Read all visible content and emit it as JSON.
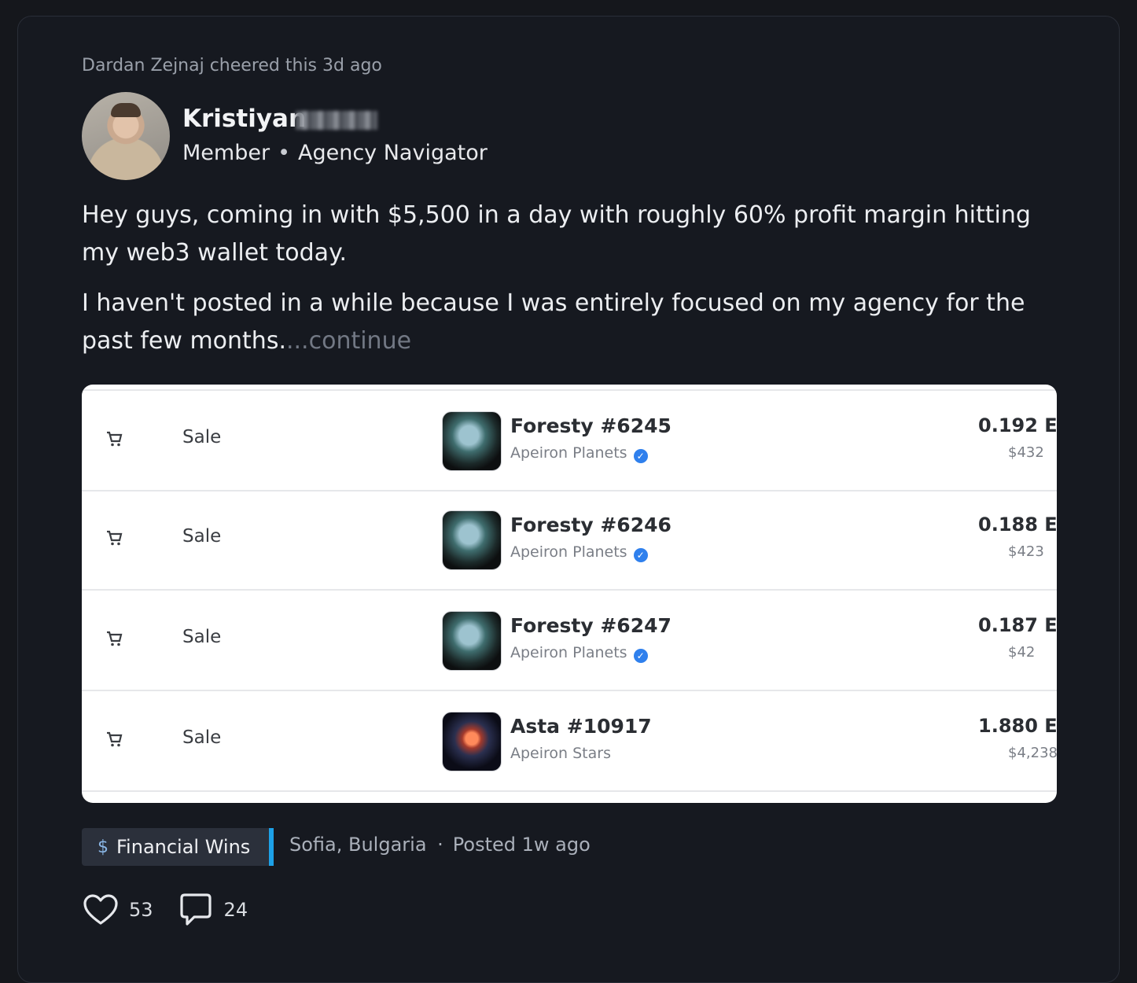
{
  "post": {
    "cheer_text": "Dardan Zejnaj cheered this 3d ago",
    "author": {
      "name": "Kristiyan",
      "role": "Member",
      "title": "Agency Navigator"
    },
    "paragraphs": [
      "Hey guys, coming in with $5,500 in a day with roughly 60% profit margin hitting my web3 wallet today.",
      "I haven't posted in a while because I was entirely focused on my agency for the past few months."
    ],
    "continue_label": "...continue",
    "screenshot_rows": [
      {
        "event": "Sale",
        "item": "Foresty #6245",
        "collection": "Apeiron Planets",
        "verified": true,
        "price": "0.192 E",
        "usd": "$432"
      },
      {
        "event": "Sale",
        "item": "Foresty #6246",
        "collection": "Apeiron Planets",
        "verified": true,
        "price": "0.188 E",
        "usd": "$423"
      },
      {
        "event": "Sale",
        "item": "Foresty #6247",
        "collection": "Apeiron Planets",
        "verified": true,
        "price": "0.187 E",
        "usd": "$42"
      },
      {
        "event": "Sale",
        "item": "Asta #10917",
        "collection": "Apeiron Stars",
        "verified": false,
        "price": "1.880 E",
        "usd": "$4,238"
      }
    ],
    "category": "Financial Wins",
    "location": "Sofia, Bulgaria",
    "posted": "Posted 1w ago",
    "likes": "53",
    "comments": "24",
    "colors": {
      "background": "#161920",
      "category_accent": "#1da1e8",
      "verified_badge": "#2f80ed",
      "continue_text": "#727884"
    },
    "icons": [
      "money-bag-icon",
      "cart-icon",
      "verified-icon",
      "heart-icon",
      "comment-icon"
    ]
  }
}
